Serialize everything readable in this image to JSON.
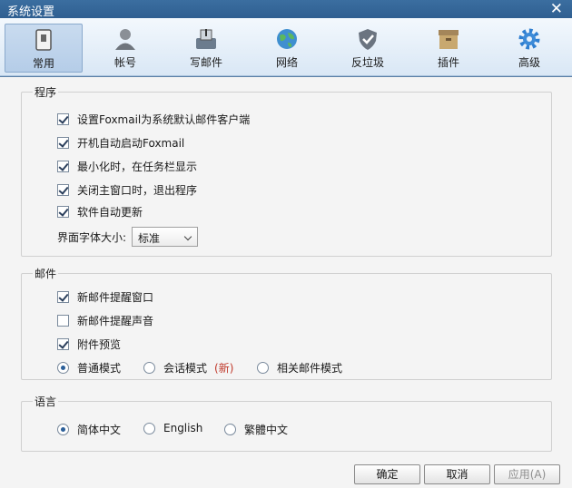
{
  "window": {
    "title": "系统设置",
    "close_symbol": "✕"
  },
  "toolbar": {
    "items": [
      {
        "label": "常用",
        "icon": "switch-icon",
        "active": true
      },
      {
        "label": "帐号",
        "icon": "user-icon"
      },
      {
        "label": "写邮件",
        "icon": "compose-icon"
      },
      {
        "label": "网络",
        "icon": "globe-icon"
      },
      {
        "label": "反垃圾",
        "icon": "shield-icon"
      },
      {
        "label": "插件",
        "icon": "box-icon"
      },
      {
        "label": "高级",
        "icon": "gear-icon"
      }
    ]
  },
  "program": {
    "title": "程序",
    "options": [
      {
        "label": "设置Foxmail为系统默认邮件客户端",
        "checked": true
      },
      {
        "label": "开机自动启动Foxmail",
        "checked": true
      },
      {
        "label": "最小化时，在任务栏显示",
        "checked": true
      },
      {
        "label": "关闭主窗口时，退出程序",
        "checked": true
      },
      {
        "label": "软件自动更新",
        "checked": true
      }
    ],
    "font_size_label": "界面字体大小:",
    "font_size_value": "标准"
  },
  "mail": {
    "title": "邮件",
    "options": [
      {
        "label": "新邮件提醒窗口",
        "checked": true
      },
      {
        "label": "新邮件提醒声音",
        "checked": false
      },
      {
        "label": "附件预览",
        "checked": true
      }
    ],
    "modes": [
      {
        "label": "普通模式",
        "selected": true
      },
      {
        "label": "会话模式",
        "selected": false,
        "tag": "(新)"
      },
      {
        "label": "相关邮件模式",
        "selected": false
      }
    ]
  },
  "language": {
    "title": "语言",
    "options": [
      {
        "label": "简体中文",
        "selected": true
      },
      {
        "label": "English",
        "selected": false
      },
      {
        "label": "繁體中文",
        "selected": false
      }
    ]
  },
  "footer": {
    "ok": "确定",
    "cancel": "取消",
    "apply": "应用(A)"
  },
  "colors": {
    "titlebar": "#2f5f91",
    "toolbar_active": "#b5cde8",
    "new_tag": "#c0392b",
    "radio_dot": "#2b5f99"
  }
}
